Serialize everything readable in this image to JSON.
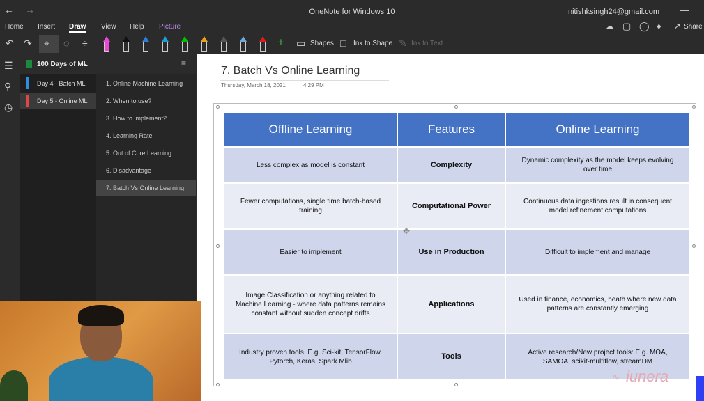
{
  "window": {
    "title": "OneNote for Windows 10",
    "account": "nitishksingh24@gmail.com"
  },
  "menu": {
    "home": "Home",
    "insert": "Insert",
    "draw": "Draw",
    "view": "View",
    "help": "Help",
    "picture": "Picture",
    "share": "Share"
  },
  "toolbar": {
    "shapes": "Shapes",
    "ink_to_shape": "Ink to Shape",
    "ink_to_text": "Ink to Text",
    "pen_colors": [
      "#e84ad6",
      "#111111",
      "#2f7bd6",
      "#1e9ad6",
      "#00c000",
      "#e8a020",
      "#555555",
      "#6fa8dc",
      "#d81e1e"
    ]
  },
  "notebook": {
    "name": "100 Days of ML",
    "sections": [
      {
        "label": "Day 4 - Batch ML",
        "color": "#2f8de4"
      },
      {
        "label": "Day 5 - Online ML",
        "color": "#e04848"
      }
    ],
    "pages": [
      "1. Online Machine Learning",
      "2. When to use?",
      "3. How to implement?",
      "4. Learning Rate",
      "5. Out of Core Learning",
      "6. Disadvantage",
      "7. Batch Vs Online Learning"
    ]
  },
  "page": {
    "title": "7. Batch Vs Online Learning",
    "date": "Thursday, March 18, 2021",
    "time": "4:29 PM"
  },
  "table": {
    "headers": [
      "Offline Learning",
      "Features",
      "Online Learning"
    ],
    "rows": [
      {
        "offline": "Less complex as model is constant",
        "feature": "Complexity",
        "online": "Dynamic complexity as the model keeps evolving over time"
      },
      {
        "offline": "Fewer computations, single time batch-based training",
        "feature": "Computational Power",
        "online": "Continuous data ingestions result in consequent model refinement computations"
      },
      {
        "offline": "Easier to implement",
        "feature": "Use in Production",
        "online": "Difficult to implement and manage"
      },
      {
        "offline": "Image Classification or anything related to Machine Learning - where data patterns remains constant without sudden concept drifts",
        "feature": "Applications",
        "online": "Used in finance, economics, heath where new data patterns are constantly emerging"
      },
      {
        "offline": "Industry proven tools. E.g. Sci-kit, TensorFlow, Pytorch, Keras, Spark Mlib",
        "feature": "Tools",
        "online": "Active research/New project tools: E.g. MOA, SAMOA, scikit-multiflow, streamDM"
      }
    ]
  },
  "watermark": "iunera"
}
